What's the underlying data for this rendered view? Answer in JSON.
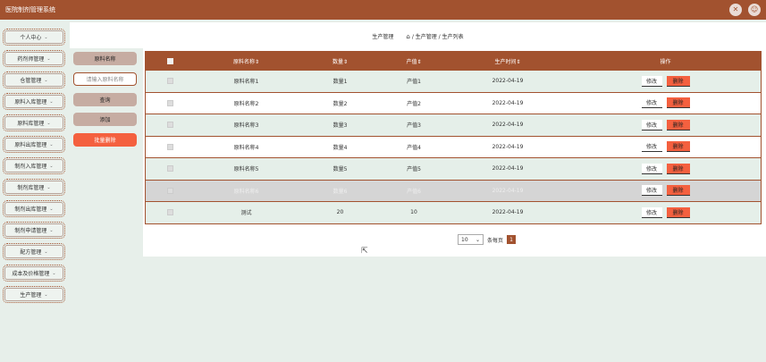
{
  "app": {
    "title": "医院制剂管理系统"
  },
  "topbar": {
    "expand_icon": "expand-icon",
    "user_icon": "user-icon"
  },
  "sidebar": {
    "items": [
      {
        "label": "个人中心"
      },
      {
        "label": "药剂师管理"
      },
      {
        "label": "仓管管理"
      },
      {
        "label": "原料入库管理"
      },
      {
        "label": "原料库管理"
      },
      {
        "label": "原料出库管理"
      },
      {
        "label": "制剂入库管理"
      },
      {
        "label": "制剂库管理"
      },
      {
        "label": "制剂出库管理"
      },
      {
        "label": "制剂申请管理"
      },
      {
        "label": "配方管理"
      },
      {
        "label": "成本及价格管理"
      },
      {
        "label": "生产管理"
      }
    ]
  },
  "breadcrumb": {
    "section": "生产管理",
    "path": "/ 生产管理 / 生产列表"
  },
  "controls": {
    "filter_label": "原料名称",
    "filter_placeholder": "请输入原料名称",
    "query": "查询",
    "add": "添加",
    "batch_delete": "批量删除"
  },
  "table": {
    "headers": {
      "name": "原料名称",
      "qty": "数量",
      "value": "产值",
      "date": "生产时间",
      "ops": "操作"
    },
    "sort_glyph": "⇕",
    "edit_label": "修改",
    "delete_label": "删除",
    "rows": [
      {
        "name": "原料名称1",
        "qty": "数量1",
        "value": "产值1",
        "date": "2022-04-19"
      },
      {
        "name": "原料名称2",
        "qty": "数量2",
        "value": "产值2",
        "date": "2022-04-19"
      },
      {
        "name": "原料名称3",
        "qty": "数量3",
        "value": "产值3",
        "date": "2022-04-19"
      },
      {
        "name": "原料名称4",
        "qty": "数量4",
        "value": "产值4",
        "date": "2022-04-19"
      },
      {
        "name": "原料名称5",
        "qty": "数量5",
        "value": "产值5",
        "date": "2022-04-19"
      },
      {
        "name": "原料名称6",
        "qty": "数量6",
        "value": "产值6",
        "date": "2022-04-19"
      },
      {
        "name": "测试",
        "qty": "20",
        "value": "10",
        "date": "2022-04-19"
      }
    ]
  },
  "pagination": {
    "page_size": "10",
    "per_page_label": "条每页",
    "current_page": "1"
  }
}
